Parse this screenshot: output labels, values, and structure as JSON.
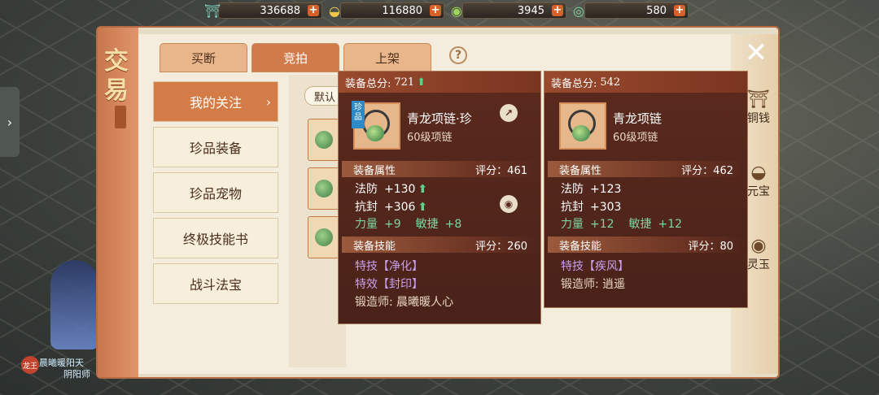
{
  "currency": [
    {
      "icon": "jade-gate-icon",
      "value": "336688"
    },
    {
      "icon": "gold-ingot-icon",
      "value": "116880"
    },
    {
      "icon": "green-coin-icon",
      "value": "3945"
    },
    {
      "icon": "jade-ring-icon",
      "value": "580"
    }
  ],
  "plus_label": "+",
  "title": {
    "char1": "交",
    "char2": "易"
  },
  "tabs": [
    {
      "label": "买断",
      "active": false
    },
    {
      "label": "竞拍",
      "active": true
    },
    {
      "label": "上架",
      "active": false
    }
  ],
  "help_label": "?",
  "close_label": "✕",
  "nav": [
    {
      "label": "我的关注",
      "active": true
    },
    {
      "label": "珍品装备",
      "active": false
    },
    {
      "label": "珍品宠物",
      "active": false
    },
    {
      "label": "终极技能书",
      "active": false
    },
    {
      "label": "战斗法宝",
      "active": false
    }
  ],
  "sort_label": "默认",
  "resources": [
    {
      "icon": "coin-string-icon",
      "label": "铜钱"
    },
    {
      "icon": "yuanbao-icon",
      "label": "元宝"
    },
    {
      "icon": "spirit-jade-icon",
      "label": "灵玉"
    }
  ],
  "player": {
    "badge": "龙王",
    "name": "晨曦暖阳天",
    "class": "阴阳师"
  },
  "compare_left": {
    "total_label": "装备总分:",
    "total": "721",
    "up_mark": "⬆",
    "rare_badge": "珍品",
    "name": "青龙项链·珍",
    "level": "60级项链",
    "attr_title": "装备属性",
    "attr_score": "评分：461",
    "attrs": [
      {
        "k": "法防",
        "v": "+130",
        "up": "⬆"
      },
      {
        "k": "抗封",
        "v": "+306",
        "up": "⬆"
      }
    ],
    "attr_row3": {
      "k1": "力量",
      "v1": "+9",
      "k2": "敏捷",
      "v2": "+8"
    },
    "skill_title": "装备技能",
    "skill_score": "评分：260",
    "skills": [
      "特技【净化】",
      "特效【封印】"
    ],
    "smith": "锻造师: 晨曦暖人心"
  },
  "compare_right": {
    "total_label": "装备总分:",
    "total": "542",
    "name": "青龙项链",
    "level": "60级项链",
    "attr_title": "装备属性",
    "attr_score": "评分：462",
    "attrs": [
      {
        "k": "法防",
        "v": "+123"
      },
      {
        "k": "抗封",
        "v": "+303"
      }
    ],
    "attr_row3": {
      "k1": "力量",
      "v1": "+12",
      "k2": "敏捷",
      "v2": "+12"
    },
    "skill_title": "装备技能",
    "skill_score": "评分：80",
    "skills": [
      "特技【疾风】"
    ],
    "smith": "锻造师: 逍遥"
  }
}
